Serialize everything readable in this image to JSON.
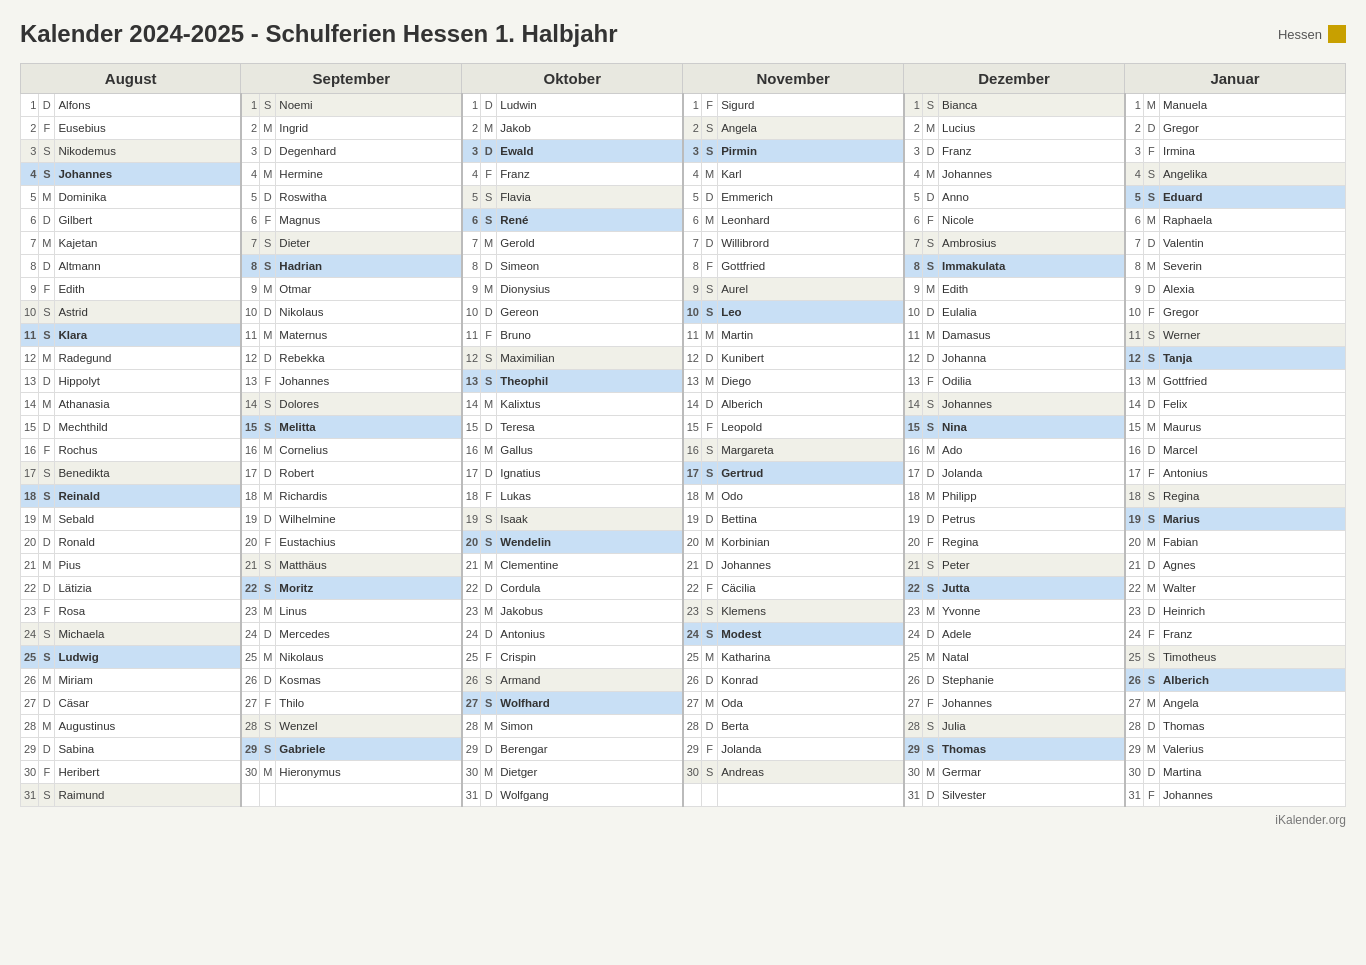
{
  "title": "Kalender 2024-2025 - Schulferien Hessen 1. Halbjahr",
  "badge": "Hessen",
  "footer": "iKalender.org",
  "months": [
    "August",
    "September",
    "Oktober",
    "November",
    "Dezember",
    "Januar"
  ],
  "rows": [
    {
      "day": 1,
      "cols": [
        {
          "wd": "D",
          "name": "Alfons",
          "hl": ""
        },
        {
          "wd": "S",
          "name": "Noemi",
          "hl": ""
        },
        {
          "wd": "D",
          "name": "Ludwin",
          "hl": ""
        },
        {
          "wd": "F",
          "name": "Sigurd",
          "hl": ""
        },
        {
          "wd": "S",
          "name": "Bianca",
          "hl": ""
        },
        {
          "wd": "M",
          "name": "Manuela",
          "hl": ""
        }
      ]
    },
    {
      "day": 2,
      "cols": [
        {
          "wd": "F",
          "name": "Eusebius",
          "hl": ""
        },
        {
          "wd": "M",
          "name": "Ingrid",
          "hl": ""
        },
        {
          "wd": "M",
          "name": "Jakob",
          "hl": ""
        },
        {
          "wd": "S",
          "name": "Angela",
          "hl": ""
        },
        {
          "wd": "M",
          "name": "Lucius",
          "hl": ""
        },
        {
          "wd": "D",
          "name": "Gregor",
          "hl": ""
        }
      ]
    },
    {
      "day": 3,
      "cols": [
        {
          "wd": "S",
          "name": "Nikodemus",
          "hl": ""
        },
        {
          "wd": "D",
          "name": "Degenhard",
          "hl": ""
        },
        {
          "wd": "D",
          "name": "Ewald",
          "hl": "blue"
        },
        {
          "wd": "S",
          "name": "Pirmin",
          "hl": "blue"
        },
        {
          "wd": "D",
          "name": "Franz",
          "hl": ""
        },
        {
          "wd": "F",
          "name": "Irmina",
          "hl": ""
        }
      ]
    },
    {
      "day": 4,
      "cols": [
        {
          "wd": "S",
          "name": "Johannes",
          "hl": "blue"
        },
        {
          "wd": "M",
          "name": "Hermine",
          "hl": ""
        },
        {
          "wd": "F",
          "name": "Franz",
          "hl": ""
        },
        {
          "wd": "M",
          "name": "Karl",
          "hl": ""
        },
        {
          "wd": "M",
          "name": "Johannes",
          "hl": ""
        },
        {
          "wd": "S",
          "name": "Angelika",
          "hl": ""
        }
      ]
    },
    {
      "day": 5,
      "cols": [
        {
          "wd": "M",
          "name": "Dominika",
          "hl": ""
        },
        {
          "wd": "D",
          "name": "Roswitha",
          "hl": ""
        },
        {
          "wd": "S",
          "name": "Flavia",
          "hl": ""
        },
        {
          "wd": "D",
          "name": "Emmerich",
          "hl": ""
        },
        {
          "wd": "D",
          "name": "Anno",
          "hl": ""
        },
        {
          "wd": "S",
          "name": "Eduard",
          "hl": "blue"
        }
      ]
    },
    {
      "day": 6,
      "cols": [
        {
          "wd": "D",
          "name": "Gilbert",
          "hl": ""
        },
        {
          "wd": "F",
          "name": "Magnus",
          "hl": ""
        },
        {
          "wd": "S",
          "name": "René",
          "hl": "blue"
        },
        {
          "wd": "M",
          "name": "Leonhard",
          "hl": ""
        },
        {
          "wd": "F",
          "name": "Nicole",
          "hl": ""
        },
        {
          "wd": "M",
          "name": "Raphaela",
          "hl": ""
        }
      ]
    },
    {
      "day": 7,
      "cols": [
        {
          "wd": "M",
          "name": "Kajetan",
          "hl": ""
        },
        {
          "wd": "S",
          "name": "Dieter",
          "hl": ""
        },
        {
          "wd": "M",
          "name": "Gerold",
          "hl": ""
        },
        {
          "wd": "D",
          "name": "Willibrord",
          "hl": ""
        },
        {
          "wd": "S",
          "name": "Ambrosius",
          "hl": ""
        },
        {
          "wd": "D",
          "name": "Valentin",
          "hl": ""
        }
      ]
    },
    {
      "day": 8,
      "cols": [
        {
          "wd": "D",
          "name": "Altmann",
          "hl": ""
        },
        {
          "wd": "S",
          "name": "Hadrian",
          "hl": "blue"
        },
        {
          "wd": "D",
          "name": "Simeon",
          "hl": ""
        },
        {
          "wd": "F",
          "name": "Gottfried",
          "hl": ""
        },
        {
          "wd": "S",
          "name": "Immakulata",
          "hl": "blue"
        },
        {
          "wd": "M",
          "name": "Severin",
          "hl": ""
        }
      ]
    },
    {
      "day": 9,
      "cols": [
        {
          "wd": "F",
          "name": "Edith",
          "hl": ""
        },
        {
          "wd": "M",
          "name": "Otmar",
          "hl": ""
        },
        {
          "wd": "M",
          "name": "Dionysius",
          "hl": ""
        },
        {
          "wd": "S",
          "name": "Aurel",
          "hl": ""
        },
        {
          "wd": "M",
          "name": "Edith",
          "hl": ""
        },
        {
          "wd": "D",
          "name": "Alexia",
          "hl": ""
        }
      ]
    },
    {
      "day": 10,
      "cols": [
        {
          "wd": "S",
          "name": "Astrid",
          "hl": ""
        },
        {
          "wd": "D",
          "name": "Nikolaus",
          "hl": ""
        },
        {
          "wd": "D",
          "name": "Gereon",
          "hl": ""
        },
        {
          "wd": "S",
          "name": "Leo",
          "hl": "blue"
        },
        {
          "wd": "D",
          "name": "Eulalia",
          "hl": ""
        },
        {
          "wd": "F",
          "name": "Gregor",
          "hl": ""
        }
      ]
    },
    {
      "day": 11,
      "cols": [
        {
          "wd": "S",
          "name": "Klara",
          "hl": "blue"
        },
        {
          "wd": "M",
          "name": "Maternus",
          "hl": ""
        },
        {
          "wd": "F",
          "name": "Bruno",
          "hl": ""
        },
        {
          "wd": "M",
          "name": "Martin",
          "hl": ""
        },
        {
          "wd": "M",
          "name": "Damasus",
          "hl": ""
        },
        {
          "wd": "S",
          "name": "Werner",
          "hl": ""
        }
      ]
    },
    {
      "day": 12,
      "cols": [
        {
          "wd": "M",
          "name": "Radegund",
          "hl": ""
        },
        {
          "wd": "D",
          "name": "Rebekka",
          "hl": ""
        },
        {
          "wd": "S",
          "name": "Maximilian",
          "hl": ""
        },
        {
          "wd": "D",
          "name": "Kunibert",
          "hl": ""
        },
        {
          "wd": "D",
          "name": "Johanna",
          "hl": ""
        },
        {
          "wd": "S",
          "name": "Tanja",
          "hl": "blue"
        }
      ]
    },
    {
      "day": 13,
      "cols": [
        {
          "wd": "D",
          "name": "Hippolyt",
          "hl": ""
        },
        {
          "wd": "F",
          "name": "Johannes",
          "hl": ""
        },
        {
          "wd": "S",
          "name": "Theophil",
          "hl": "blue"
        },
        {
          "wd": "M",
          "name": "Diego",
          "hl": ""
        },
        {
          "wd": "F",
          "name": "Odilia",
          "hl": ""
        },
        {
          "wd": "M",
          "name": "Gottfried",
          "hl": ""
        }
      ]
    },
    {
      "day": 14,
      "cols": [
        {
          "wd": "M",
          "name": "Athanasia",
          "hl": ""
        },
        {
          "wd": "S",
          "name": "Dolores",
          "hl": ""
        },
        {
          "wd": "M",
          "name": "Kalixtus",
          "hl": ""
        },
        {
          "wd": "D",
          "name": "Alberich",
          "hl": ""
        },
        {
          "wd": "S",
          "name": "Johannes",
          "hl": ""
        },
        {
          "wd": "D",
          "name": "Felix",
          "hl": ""
        }
      ]
    },
    {
      "day": 15,
      "cols": [
        {
          "wd": "D",
          "name": "Mechthild",
          "hl": ""
        },
        {
          "wd": "S",
          "name": "Melitta",
          "hl": "blue"
        },
        {
          "wd": "D",
          "name": "Teresa",
          "hl": ""
        },
        {
          "wd": "F",
          "name": "Leopold",
          "hl": ""
        },
        {
          "wd": "S",
          "name": "Nina",
          "hl": "blue"
        },
        {
          "wd": "M",
          "name": "Maurus",
          "hl": ""
        }
      ]
    },
    {
      "day": 16,
      "cols": [
        {
          "wd": "F",
          "name": "Rochus",
          "hl": ""
        },
        {
          "wd": "M",
          "name": "Cornelius",
          "hl": ""
        },
        {
          "wd": "M",
          "name": "Gallus",
          "hl": ""
        },
        {
          "wd": "S",
          "name": "Margareta",
          "hl": ""
        },
        {
          "wd": "M",
          "name": "Ado",
          "hl": ""
        },
        {
          "wd": "D",
          "name": "Marcel",
          "hl": ""
        }
      ]
    },
    {
      "day": 17,
      "cols": [
        {
          "wd": "S",
          "name": "Benedikta",
          "hl": ""
        },
        {
          "wd": "D",
          "name": "Robert",
          "hl": ""
        },
        {
          "wd": "D",
          "name": "Ignatius",
          "hl": ""
        },
        {
          "wd": "S",
          "name": "Gertrud",
          "hl": "blue"
        },
        {
          "wd": "D",
          "name": "Jolanda",
          "hl": ""
        },
        {
          "wd": "F",
          "name": "Antonius",
          "hl": ""
        }
      ]
    },
    {
      "day": 18,
      "cols": [
        {
          "wd": "S",
          "name": "Reinald",
          "hl": "blue"
        },
        {
          "wd": "M",
          "name": "Richardis",
          "hl": ""
        },
        {
          "wd": "F",
          "name": "Lukas",
          "hl": ""
        },
        {
          "wd": "M",
          "name": "Odo",
          "hl": ""
        },
        {
          "wd": "M",
          "name": "Philipp",
          "hl": ""
        },
        {
          "wd": "S",
          "name": "Regina",
          "hl": ""
        }
      ]
    },
    {
      "day": 19,
      "cols": [
        {
          "wd": "M",
          "name": "Sebald",
          "hl": ""
        },
        {
          "wd": "D",
          "name": "Wilhelmine",
          "hl": ""
        },
        {
          "wd": "S",
          "name": "Isaak",
          "hl": ""
        },
        {
          "wd": "D",
          "name": "Bettina",
          "hl": ""
        },
        {
          "wd": "D",
          "name": "Petrus",
          "hl": ""
        },
        {
          "wd": "S",
          "name": "Marius",
          "hl": "blue"
        }
      ]
    },
    {
      "day": 20,
      "cols": [
        {
          "wd": "D",
          "name": "Ronald",
          "hl": ""
        },
        {
          "wd": "F",
          "name": "Eustachius",
          "hl": ""
        },
        {
          "wd": "S",
          "name": "Wendelin",
          "hl": "blue"
        },
        {
          "wd": "M",
          "name": "Korbinian",
          "hl": ""
        },
        {
          "wd": "F",
          "name": "Regina",
          "hl": ""
        },
        {
          "wd": "M",
          "name": "Fabian",
          "hl": ""
        }
      ]
    },
    {
      "day": 21,
      "cols": [
        {
          "wd": "M",
          "name": "Pius",
          "hl": ""
        },
        {
          "wd": "S",
          "name": "Matthäus",
          "hl": ""
        },
        {
          "wd": "M",
          "name": "Clementine",
          "hl": ""
        },
        {
          "wd": "D",
          "name": "Johannes",
          "hl": ""
        },
        {
          "wd": "S",
          "name": "Peter",
          "hl": ""
        },
        {
          "wd": "D",
          "name": "Agnes",
          "hl": ""
        }
      ]
    },
    {
      "day": 22,
      "cols": [
        {
          "wd": "D",
          "name": "Lätizia",
          "hl": ""
        },
        {
          "wd": "S",
          "name": "Moritz",
          "hl": "blue"
        },
        {
          "wd": "D",
          "name": "Cordula",
          "hl": ""
        },
        {
          "wd": "F",
          "name": "Cäcilia",
          "hl": ""
        },
        {
          "wd": "S",
          "name": "Jutta",
          "hl": "blue"
        },
        {
          "wd": "M",
          "name": "Walter",
          "hl": ""
        }
      ]
    },
    {
      "day": 23,
      "cols": [
        {
          "wd": "F",
          "name": "Rosa",
          "hl": ""
        },
        {
          "wd": "M",
          "name": "Linus",
          "hl": ""
        },
        {
          "wd": "M",
          "name": "Jakobus",
          "hl": ""
        },
        {
          "wd": "S",
          "name": "Klemens",
          "hl": ""
        },
        {
          "wd": "M",
          "name": "Yvonne",
          "hl": ""
        },
        {
          "wd": "D",
          "name": "Heinrich",
          "hl": ""
        }
      ]
    },
    {
      "day": 24,
      "cols": [
        {
          "wd": "S",
          "name": "Michaela",
          "hl": ""
        },
        {
          "wd": "D",
          "name": "Mercedes",
          "hl": ""
        },
        {
          "wd": "D",
          "name": "Antonius",
          "hl": ""
        },
        {
          "wd": "S",
          "name": "Modest",
          "hl": "blue"
        },
        {
          "wd": "D",
          "name": "Adele",
          "hl": ""
        },
        {
          "wd": "F",
          "name": "Franz",
          "hl": ""
        }
      ]
    },
    {
      "day": 25,
      "cols": [
        {
          "wd": "S",
          "name": "Ludwig",
          "hl": "blue"
        },
        {
          "wd": "M",
          "name": "Nikolaus",
          "hl": ""
        },
        {
          "wd": "F",
          "name": "Crispin",
          "hl": ""
        },
        {
          "wd": "M",
          "name": "Katharina",
          "hl": ""
        },
        {
          "wd": "M",
          "name": "Natal",
          "hl": ""
        },
        {
          "wd": "S",
          "name": "Timotheus",
          "hl": ""
        }
      ]
    },
    {
      "day": 26,
      "cols": [
        {
          "wd": "M",
          "name": "Miriam",
          "hl": ""
        },
        {
          "wd": "D",
          "name": "Kosmas",
          "hl": ""
        },
        {
          "wd": "S",
          "name": "Armand",
          "hl": ""
        },
        {
          "wd": "D",
          "name": "Konrad",
          "hl": ""
        },
        {
          "wd": "D",
          "name": "Stephanie",
          "hl": ""
        },
        {
          "wd": "S",
          "name": "Alberich",
          "hl": "blue"
        }
      ]
    },
    {
      "day": 27,
      "cols": [
        {
          "wd": "D",
          "name": "Cäsar",
          "hl": ""
        },
        {
          "wd": "F",
          "name": "Thilo",
          "hl": ""
        },
        {
          "wd": "S",
          "name": "Wolfhard",
          "hl": "blue"
        },
        {
          "wd": "M",
          "name": "Oda",
          "hl": ""
        },
        {
          "wd": "F",
          "name": "Johannes",
          "hl": ""
        },
        {
          "wd": "M",
          "name": "Angela",
          "hl": ""
        }
      ]
    },
    {
      "day": 28,
      "cols": [
        {
          "wd": "M",
          "name": "Augustinus",
          "hl": ""
        },
        {
          "wd": "S",
          "name": "Wenzel",
          "hl": ""
        },
        {
          "wd": "M",
          "name": "Simon",
          "hl": ""
        },
        {
          "wd": "D",
          "name": "Berta",
          "hl": ""
        },
        {
          "wd": "S",
          "name": "Julia",
          "hl": ""
        },
        {
          "wd": "D",
          "name": "Thomas",
          "hl": ""
        }
      ]
    },
    {
      "day": 29,
      "cols": [
        {
          "wd": "D",
          "name": "Sabina",
          "hl": ""
        },
        {
          "wd": "S",
          "name": "Gabriele",
          "hl": "blue"
        },
        {
          "wd": "D",
          "name": "Berengar",
          "hl": ""
        },
        {
          "wd": "F",
          "name": "Jolanda",
          "hl": ""
        },
        {
          "wd": "S",
          "name": "Thomas",
          "hl": "blue"
        },
        {
          "wd": "M",
          "name": "Valerius",
          "hl": ""
        }
      ]
    },
    {
      "day": 30,
      "cols": [
        {
          "wd": "F",
          "name": "Heribert",
          "hl": ""
        },
        {
          "wd": "M",
          "name": "Hieronymus",
          "hl": ""
        },
        {
          "wd": "M",
          "name": "Dietger",
          "hl": ""
        },
        {
          "wd": "S",
          "name": "Andreas",
          "hl": ""
        },
        {
          "wd": "M",
          "name": "Germar",
          "hl": ""
        },
        {
          "wd": "D",
          "name": "Martina",
          "hl": ""
        }
      ]
    },
    {
      "day": 31,
      "cols": [
        {
          "wd": "S",
          "name": "Raimund",
          "hl": ""
        },
        {
          "wd": "",
          "name": "",
          "hl": ""
        },
        {
          "wd": "D",
          "name": "Wolfgang",
          "hl": ""
        },
        {
          "wd": "",
          "name": "",
          "hl": ""
        },
        {
          "wd": "D",
          "name": "Silvester",
          "hl": ""
        },
        {
          "wd": "F",
          "name": "Johannes",
          "hl": ""
        }
      ]
    }
  ]
}
